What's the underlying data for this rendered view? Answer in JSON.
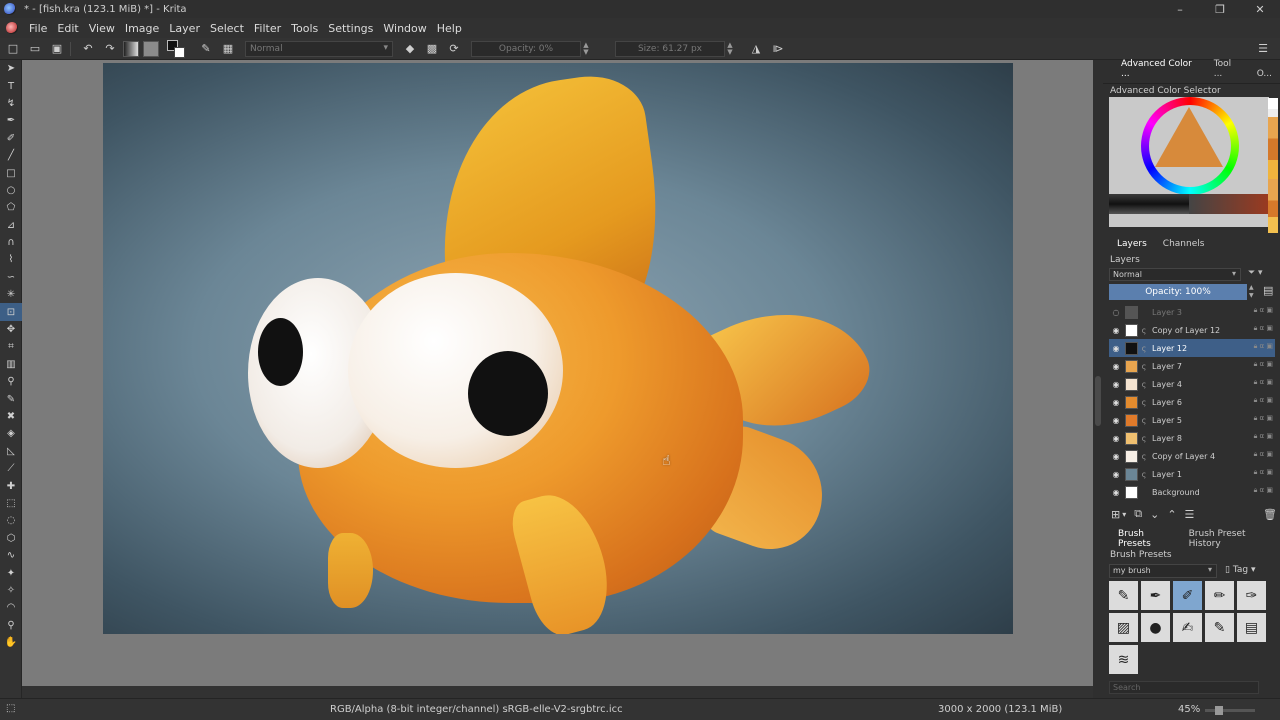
{
  "window": {
    "title": "* - [fish.kra (123.1 MiB) *] - Krita",
    "buttons": [
      "–",
      "❐",
      "✕"
    ]
  },
  "menu": [
    "File",
    "Edit",
    "View",
    "Image",
    "Layer",
    "Select",
    "Filter",
    "Tools",
    "Settings",
    "Window",
    "Help"
  ],
  "toolbar": {
    "blend_mode": "Normal",
    "opacity": "Opacity: 0%",
    "size": "Size: 61.27 px"
  },
  "dock": {
    "tabs": [
      "Advanced Color ...",
      "Tool ...",
      "O..."
    ],
    "color_selector_title": "Advanced Color Selector",
    "layers_tabs": [
      "Layers",
      "Channels"
    ],
    "layers_title": "Layers",
    "layers_blend": "Normal",
    "layers_opacity": "Opacity:  100%",
    "layers": [
      {
        "name": "Layer 3",
        "state": "dim"
      },
      {
        "name": "Copy of Layer 12",
        "state": "normal"
      },
      {
        "name": "Layer 12",
        "state": "selected"
      },
      {
        "name": "Layer 7",
        "state": "normal"
      },
      {
        "name": "Layer 4",
        "state": "normal"
      },
      {
        "name": "Layer 6",
        "state": "normal"
      },
      {
        "name": "Layer 5",
        "state": "normal"
      },
      {
        "name": "Layer 8",
        "state": "normal"
      },
      {
        "name": "Copy of Layer 4",
        "state": "normal"
      },
      {
        "name": "Layer 1",
        "state": "normal"
      },
      {
        "name": "Background",
        "state": "locked"
      }
    ],
    "brush_tabs": [
      "Brush Presets",
      "Brush Preset History"
    ],
    "brush_title": "Brush Presets",
    "brush_tag": "my brush",
    "tag_label": "Tag",
    "brush_search_placeholder": "Search"
  },
  "status": {
    "colorspace": "RGB/Alpha (8-bit integer/channel)  sRGB-elle-V2-srgbtrc.icc",
    "dimensions": "3000 x 2000 (123.1 MiB)",
    "zoom": "45%"
  }
}
